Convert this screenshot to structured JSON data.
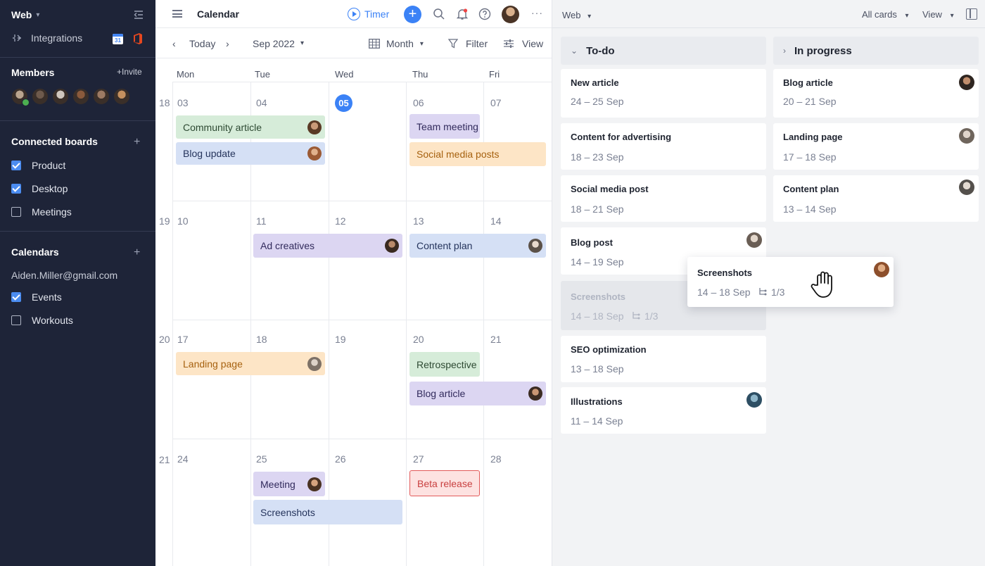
{
  "sidebar": {
    "workspace": "Web",
    "integrations_label": "Integrations",
    "gcal_day": "31",
    "members_title": "Members",
    "invite_label": "+Invite",
    "member_colors": [
      "#b9a48e",
      "#6e5a4c",
      "#cfc6bd",
      "#8a5a3c",
      "#9c7a63",
      "#c4905f"
    ],
    "boards_title": "Connected boards",
    "boards": [
      {
        "label": "Product",
        "checked": true
      },
      {
        "label": "Desktop",
        "checked": true
      },
      {
        "label": "Meetings",
        "checked": false
      }
    ],
    "calendars_title": "Calendars",
    "email": "Aiden.Miller@gmail.com",
    "calendars": [
      {
        "label": "Events",
        "checked": true
      },
      {
        "label": "Workouts",
        "checked": false
      }
    ]
  },
  "calendar": {
    "title": "Calendar",
    "timer_label": "Timer",
    "add_label": "+",
    "more_label": "···",
    "today_label": "Today",
    "month_label": "Sep 2022",
    "view_mode": "Month",
    "filter_label": "Filter",
    "view_label": "View",
    "weekdays": [
      "Mon",
      "Tue",
      "Wed",
      "Thu",
      "Fri"
    ],
    "weeks": [
      {
        "num": "18",
        "days": [
          "03",
          "04",
          "05",
          "06",
          "07"
        ]
      },
      {
        "num": "19",
        "days": [
          "10",
          "11",
          "12",
          "13",
          "14"
        ]
      },
      {
        "num": "20",
        "days": [
          "17",
          "18",
          "19",
          "20",
          "21"
        ]
      },
      {
        "num": "21",
        "days": [
          "24",
          "25",
          "26",
          "27",
          "28"
        ]
      }
    ],
    "today": "05",
    "events": {
      "community_article": "Community article",
      "blog_update": "Blog update",
      "team_meeting": "Team meeting",
      "social_media_posts": "Social media posts",
      "ad_creatives": "Ad creatives",
      "content_plan": "Content plan",
      "landing_page": "Landing page",
      "retrospective": "Retrospective",
      "blog_article": "Blog article",
      "meeting": "Meeting",
      "screenshots": "Screenshots",
      "beta_release": "Beta release"
    }
  },
  "board": {
    "workspace": "Web",
    "all_cards_label": "All cards",
    "view_label": "View",
    "columns": [
      {
        "title": "To-do",
        "cards": [
          {
            "title": "New article",
            "dates": "24 – 25 Sep"
          },
          {
            "title": "Content for advertising",
            "dates": "18 – 23 Sep"
          },
          {
            "title": "Social media post",
            "dates": "18 – 21 Sep"
          },
          {
            "title": "Blog post",
            "dates": "14 – 19 Sep"
          },
          {
            "title": "Screenshots",
            "dates": "14 – 18 Sep",
            "subtasks": "1/3"
          },
          {
            "title": "SEO optimization",
            "dates": "13 – 18 Sep"
          },
          {
            "title": "Illustrations",
            "dates": "11 – 14 Sep"
          }
        ]
      },
      {
        "title": "In progress",
        "cards": [
          {
            "title": "Blog article",
            "dates": "20 – 21 Sep"
          },
          {
            "title": "Landing page",
            "dates": "17 – 18 Sep"
          },
          {
            "title": "Content plan",
            "dates": "13 – 14 Sep"
          }
        ]
      }
    ],
    "dragging": {
      "title": "Screenshots",
      "dates": "14 – 18 Sep",
      "subtasks": "1/3"
    }
  },
  "colors": {
    "sidebar_bg": "#1e2438",
    "accent": "#3b82f6",
    "event_green": "#d6ecd9",
    "event_blue": "#d5e0f5",
    "event_purple": "#dcd6f2",
    "event_orange": "#fde5c6",
    "event_red_border": "#e25a5a"
  }
}
